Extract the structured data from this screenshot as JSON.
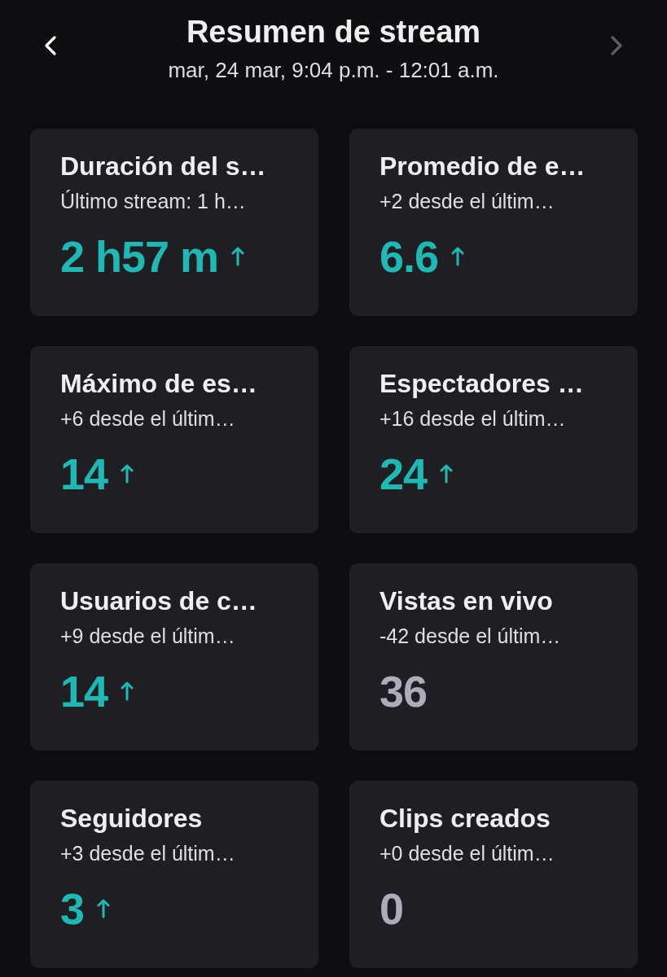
{
  "header": {
    "title": "Resumen de stream",
    "subtitle": "mar, 24 mar, 9:04 p.m. - 12:01 a.m.",
    "prev_disabled": false,
    "next_disabled": true
  },
  "cards": [
    {
      "title": "Duración del s…",
      "subtitle": "Último stream: 1 h…",
      "value": "2 h57 m",
      "increased": true
    },
    {
      "title": "Promedio de e…",
      "subtitle": "+2 desde el últim…",
      "value": "6.6",
      "increased": true
    },
    {
      "title": "Máximo de es…",
      "subtitle": "+6 desde el últim…",
      "value": "14",
      "increased": true
    },
    {
      "title": "Espectadores …",
      "subtitle": "+16 desde el últim…",
      "value": "24",
      "increased": true
    },
    {
      "title": "Usuarios de c…",
      "subtitle": "+9 desde el últim…",
      "value": "14",
      "increased": true
    },
    {
      "title": "Vistas en vivo",
      "subtitle": "-42 desde el últim…",
      "value": "36",
      "increased": false
    },
    {
      "title": "Seguidores",
      "subtitle": "+3 desde el últim…",
      "value": "3",
      "increased": true
    },
    {
      "title": "Clips creados",
      "subtitle": "+0 desde el últim…",
      "value": "0",
      "increased": false
    }
  ]
}
